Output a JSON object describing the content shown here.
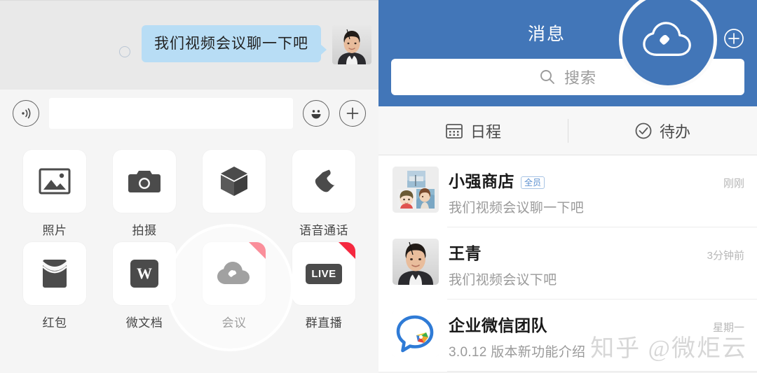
{
  "left_panel": {
    "conversation": {
      "message": {
        "text": "我们视频会议聊一下吧",
        "sender_avatar": "woman-portrait-avatar",
        "select_radio": "unselected-radio-icon"
      }
    },
    "input_bar": {
      "voice_icon": "voice-waveform-icon",
      "input_value": "",
      "input_placeholder": "",
      "emoji_icon": "smiley-face-icon",
      "plus_icon": "plus-circle-icon"
    },
    "attachments": {
      "items": [
        {
          "label": "照片",
          "icon": "photo-image-icon",
          "badge": false
        },
        {
          "label": "拍摄",
          "icon": "camera-icon",
          "badge": false
        },
        {
          "label": "",
          "icon": "cube-box-icon",
          "badge": false
        },
        {
          "label": "语音通话",
          "icon": "phone-handset-icon",
          "badge": false
        },
        {
          "label": "红包",
          "icon": "red-packet-icon",
          "badge": false
        },
        {
          "label": "微文档",
          "icon": "word-document-icon",
          "badge": false
        },
        {
          "label": "会议",
          "icon": "cloud-meeting-icon",
          "badge": true
        },
        {
          "label": "群直播",
          "icon": "live-badge-icon",
          "badge": true,
          "badge_text": "LIVE"
        }
      ],
      "highlighted": "会议"
    }
  },
  "right_panel": {
    "header": {
      "title": "消息",
      "add_icon": "plus-circle-icon",
      "spotlight_icon": "cloud-meeting-icon",
      "background_color": "#4276b8"
    },
    "search": {
      "placeholder": "搜索",
      "icon": "search-magnifier-icon"
    },
    "tabs": [
      {
        "label": "日程",
        "icon": "calendar-icon"
      },
      {
        "label": "待办",
        "icon": "check-circle-icon"
      }
    ],
    "chat_list": [
      {
        "name": "小强商店",
        "tag": "全员",
        "time": "刚刚",
        "preview": "我们视频会议聊一下吧",
        "avatar": "group-photo-avatar"
      },
      {
        "name": "王青",
        "tag": "",
        "time": "3分钟前",
        "preview": "我们视频会议下吧",
        "avatar": "woman-portrait-avatar"
      },
      {
        "name": "企业微信团队",
        "tag": "",
        "time": "星期一",
        "preview": "3.0.12 版本新功能介绍",
        "avatar": "wecom-logo-avatar"
      }
    ]
  },
  "watermark": {
    "text": "知乎 @微炬云"
  },
  "colors": {
    "brand_blue": "#4276b8",
    "bubble_blue": "#b8ddf5",
    "badge_red": "#f5283f",
    "icon_dark": "#4b4b4b"
  }
}
